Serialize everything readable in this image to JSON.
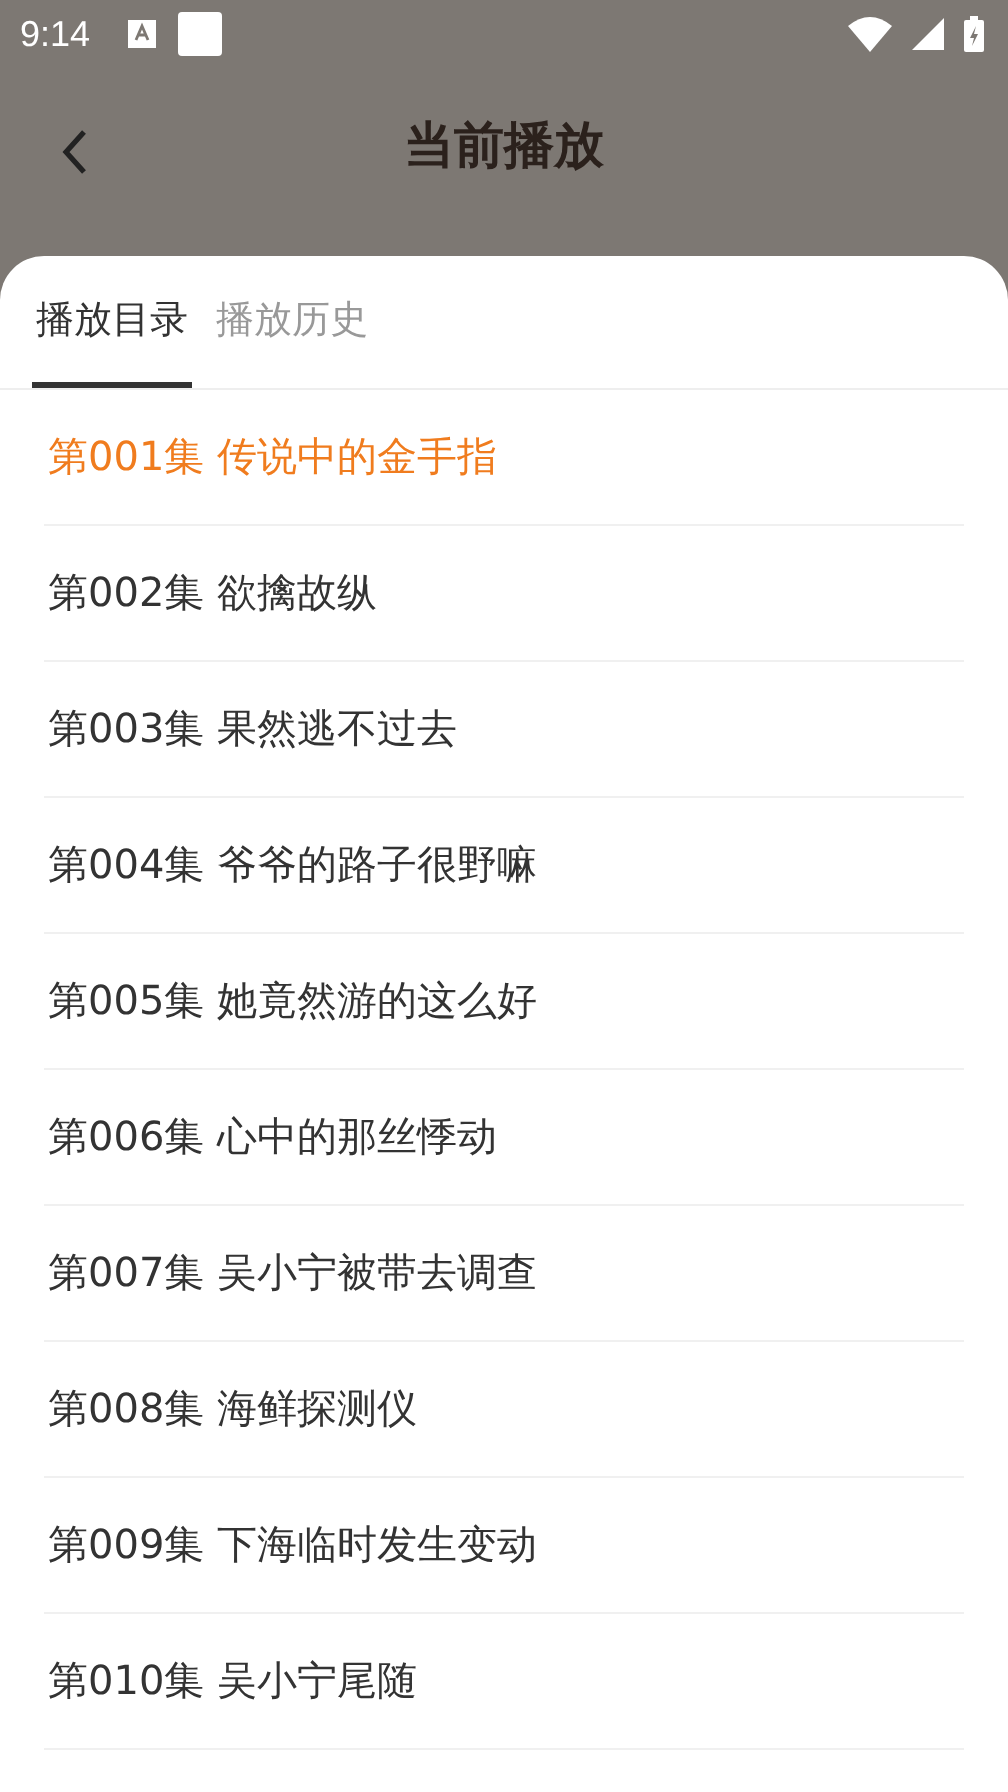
{
  "status_bar": {
    "time": "9:14"
  },
  "header": {
    "title": "当前播放"
  },
  "tabs": [
    {
      "label": "播放目录",
      "selected": true
    },
    {
      "label": "播放历史",
      "selected": false
    }
  ],
  "episodes": [
    {
      "title": "第001集 传说中的金手指",
      "selected": true
    },
    {
      "title": "第002集 欲擒故纵",
      "selected": false
    },
    {
      "title": "第003集 果然逃不过去",
      "selected": false
    },
    {
      "title": "第004集 爷爷的路子很野嘛",
      "selected": false
    },
    {
      "title": "第005集 她竟然游的这么好",
      "selected": false
    },
    {
      "title": "第006集 心中的那丝悸动",
      "selected": false
    },
    {
      "title": "第007集 吴小宁被带去调查",
      "selected": false
    },
    {
      "title": "第008集 海鲜探测仪",
      "selected": false
    },
    {
      "title": "第009集 下海临时发生变动",
      "selected": false
    },
    {
      "title": "第010集 吴小宁尾随",
      "selected": false
    }
  ]
}
